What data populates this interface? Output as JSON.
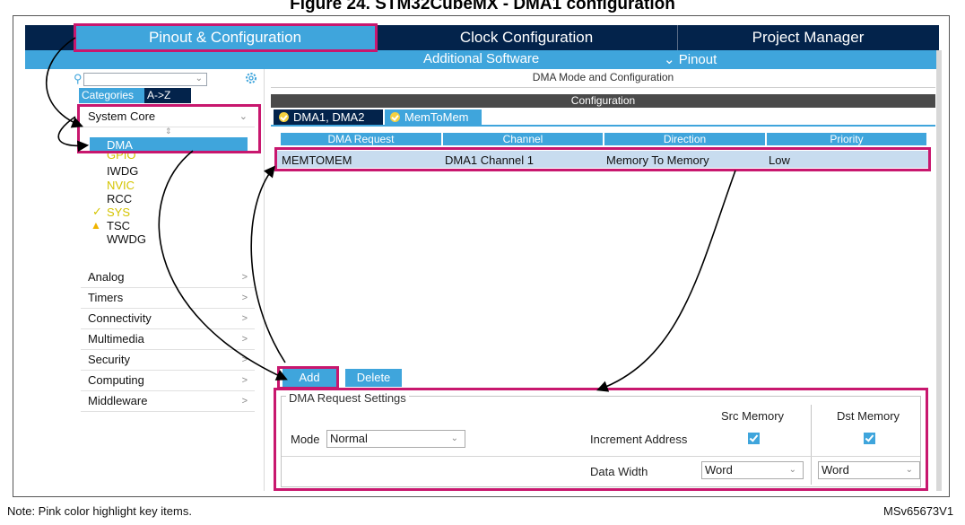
{
  "caption": "Figure 24. STM32CubeMX - DMA1 configuration",
  "top_nav": {
    "pinout": "Pinout & Configuration",
    "clock": "Clock Configuration",
    "project": "Project Manager"
  },
  "sub_nav": {
    "additional_software": "Additional Software",
    "pinout": "⌄ Pinout"
  },
  "sidebar": {
    "search_placeholder": "",
    "tabs": [
      "Categories",
      "A->Z"
    ],
    "system_core": "System Core",
    "sub_items": [
      {
        "label": "DMA",
        "color": "#ffffff"
      },
      {
        "label": "GPIO",
        "color": "#d4c400"
      },
      {
        "label": "IWDG",
        "color": "#111111"
      },
      {
        "label": "NVIC",
        "color": "#d4c400"
      },
      {
        "label": "RCC",
        "color": "#111111"
      },
      {
        "label": "SYS",
        "color": "#d4c400"
      },
      {
        "label": "TSC",
        "color": "#111111"
      },
      {
        "label": "WWDG",
        "color": "#111111"
      }
    ],
    "categories": [
      "Analog",
      "Timers",
      "Connectivity",
      "Multimedia",
      "Security",
      "Computing",
      "Middleware"
    ]
  },
  "panel": {
    "title": "DMA Mode and Configuration",
    "config_label": "Configuration",
    "tabs": [
      "DMA1, DMA2",
      "MemToMem"
    ],
    "table": {
      "headers": [
        "DMA Request",
        "Channel",
        "Direction",
        "Priority"
      ],
      "row": [
        "MEMTOMEM",
        "DMA1 Channel 1",
        "Memory To Memory",
        "Low"
      ]
    },
    "add_label": "Add",
    "delete_label": "Delete"
  },
  "settings": {
    "legend": "DMA Request Settings",
    "src_memory": "Src Memory",
    "dst_memory": "Dst Memory",
    "mode_label": "Mode",
    "mode_value": "Normal",
    "increment_address": "Increment Address",
    "data_width": "Data Width",
    "src_width": "Word",
    "dst_width": "Word"
  },
  "footer": {
    "note": "Note: Pink color highlight key items.",
    "code": "MSv65673V1"
  },
  "colors": {
    "navy": "#03234b",
    "accent": "#3fa5dc",
    "highlight": "#c8176e"
  }
}
